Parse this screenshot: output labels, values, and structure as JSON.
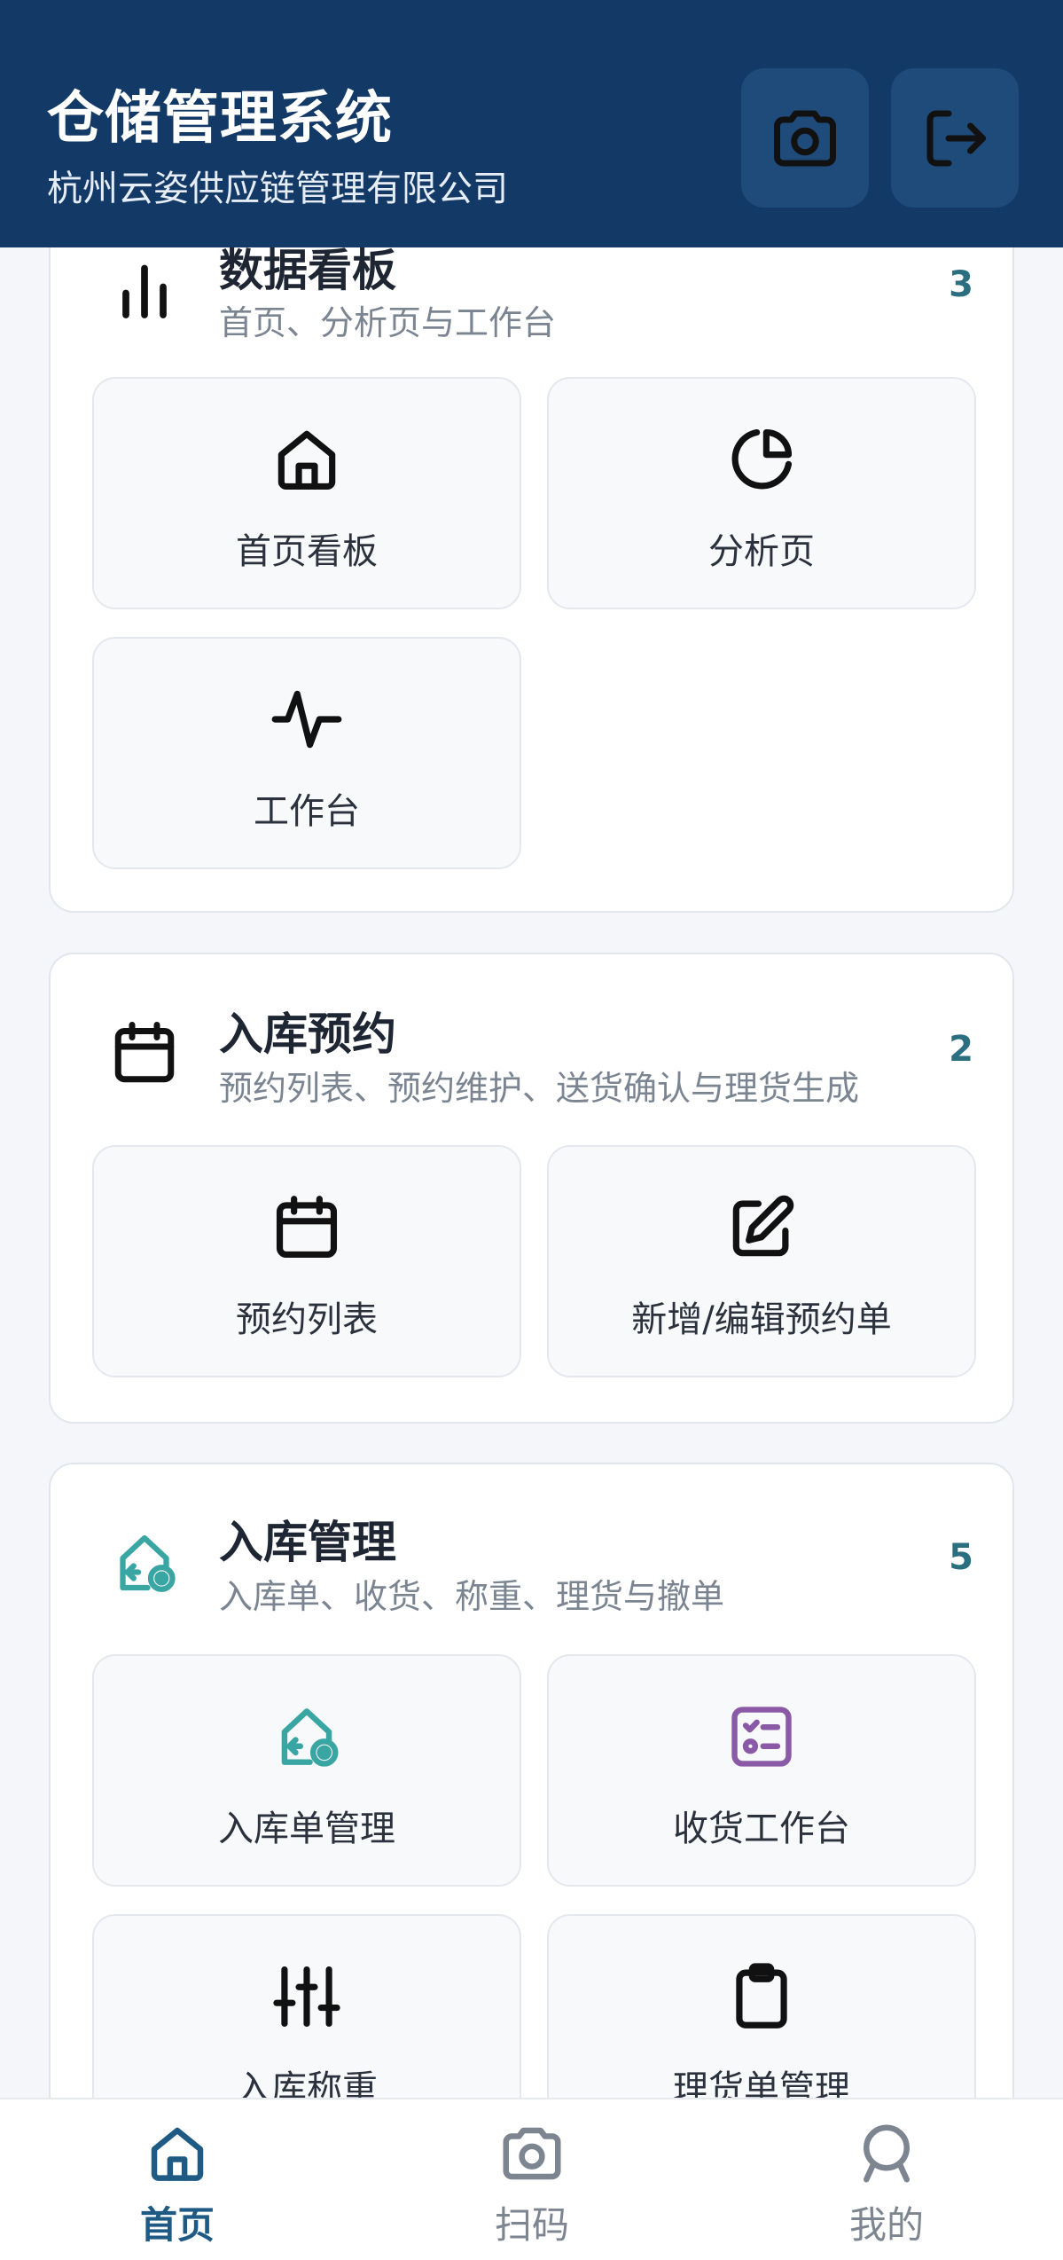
{
  "header": {
    "title": "仓储管理系统",
    "subtitle": "杭州云姿供应链管理有限公司"
  },
  "colors": {
    "header_bg": "#133a66",
    "accent_teal": "#3aa6a3",
    "accent_purple": "#8a5aa6",
    "count": "#2a6f80"
  },
  "sections": [
    {
      "title": "数据看板",
      "subtitle": "首页、分析页与工作台",
      "count": "3",
      "icon": "bar-chart-icon",
      "tiles": [
        {
          "label": "首页看板",
          "icon": "home-icon"
        },
        {
          "label": "分析页",
          "icon": "pie-chart-icon"
        },
        {
          "label": "工作台",
          "icon": "activity-icon"
        }
      ]
    },
    {
      "title": "入库预约",
      "subtitle": "预约列表、预约维护、送货确认与理货生成",
      "count": "2",
      "icon": "calendar-icon",
      "tiles": [
        {
          "label": "预约列表",
          "icon": "calendar-icon"
        },
        {
          "label": "新增/编辑预约单",
          "icon": "edit-icon"
        }
      ]
    },
    {
      "title": "入库管理",
      "subtitle": "入库单、收货、称重、理货与撤单",
      "count": "5",
      "icon": "warehouse-in-icon",
      "tiles": [
        {
          "label": "入库单管理",
          "icon": "warehouse-in-icon"
        },
        {
          "label": "收货工作台",
          "icon": "checklist-icon"
        },
        {
          "label": "入库称重",
          "icon": "sliders-icon"
        },
        {
          "label": "理货单管理",
          "icon": "clipboard-icon"
        }
      ]
    }
  ],
  "nav": [
    {
      "label": "首页",
      "icon": "home-icon",
      "active": true
    },
    {
      "label": "扫码",
      "icon": "camera-icon",
      "active": false
    },
    {
      "label": "我的",
      "icon": "user-icon",
      "active": false
    }
  ]
}
